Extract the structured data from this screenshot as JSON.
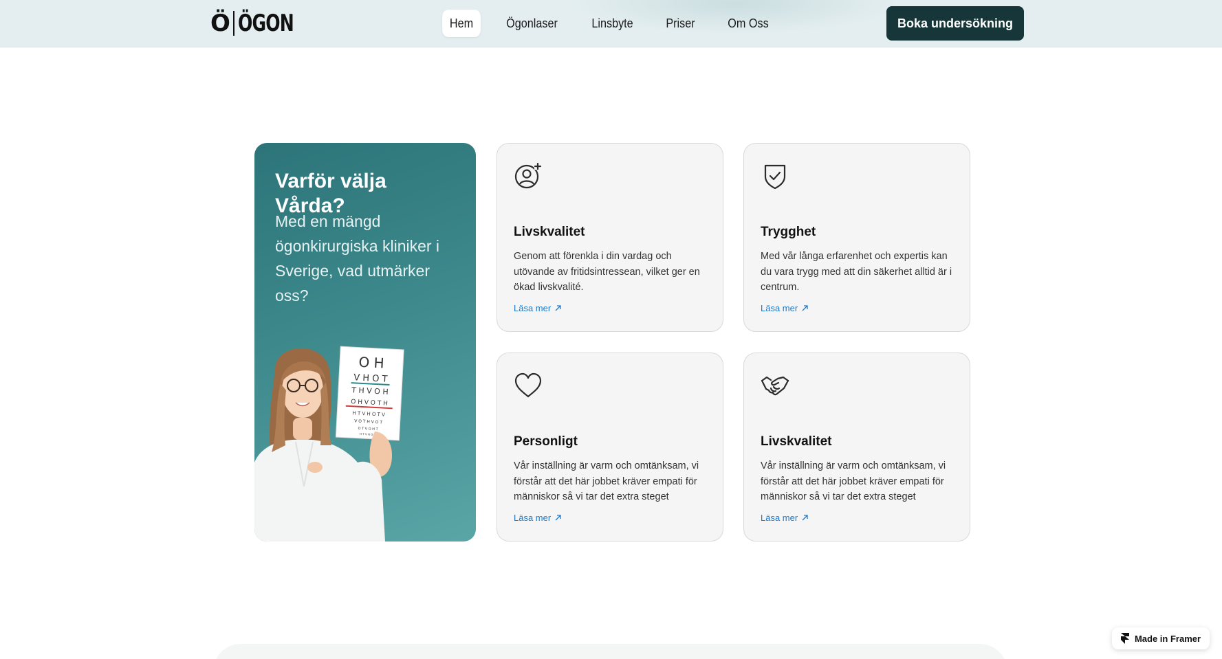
{
  "header": {
    "logo_left": "Ö",
    "logo_right": "ÖGON",
    "nav": [
      {
        "label": "Hem",
        "active": true
      },
      {
        "label": "Ögonlaser",
        "active": false
      },
      {
        "label": "Linsbyte",
        "active": false
      },
      {
        "label": "Priser",
        "active": false
      },
      {
        "label": "Om Oss",
        "active": false
      }
    ],
    "cta_label": "Boka undersökning"
  },
  "intro": {
    "title": "Varför välja Vårda?",
    "subtitle": "Med en mängd ögonkirurgiska kliniker i Sverige, vad utmärker oss?",
    "chart_rows": [
      "O H",
      "V H O T",
      "T H V O H",
      "O H V O T H",
      "H T V H O T V",
      "V O T H V O T",
      "O T V O H T",
      "H T V H O V"
    ]
  },
  "cards": [
    {
      "icon": "user-plus-icon",
      "title": "Livskvalitet",
      "desc": "Genom att förenkla i din vardag och utövande av fritidsintressean, vilket ger en ökad livskvalité.",
      "link": "Läsa mer"
    },
    {
      "icon": "shield-check-icon",
      "title": "Trygghet",
      "desc": "Med vår långa erfarenhet och expertis kan du vara trygg med att din säkerhet alltid är i centrum.",
      "link": "Läsa mer"
    },
    {
      "icon": "heart-icon",
      "title": "Personligt",
      "desc": "Vår inställning är varm och omtänksam, vi förstår att det här jobbet kräver empati för människor så vi tar det extra steget",
      "link": "Läsa mer"
    },
    {
      "icon": "handshake-icon",
      "title": "Livskvalitet",
      "desc": "Vår inställning är varm och omtänksam, vi förstår att det här jobbet kräver empati för människor så vi tar det extra steget",
      "link": "Läsa mer"
    }
  ],
  "badge": {
    "label": "Made in Framer"
  },
  "colors": {
    "primary": "#17363a",
    "teal": "#3d898c",
    "link": "#1e79c8",
    "header_bg": "#e4eef0"
  }
}
